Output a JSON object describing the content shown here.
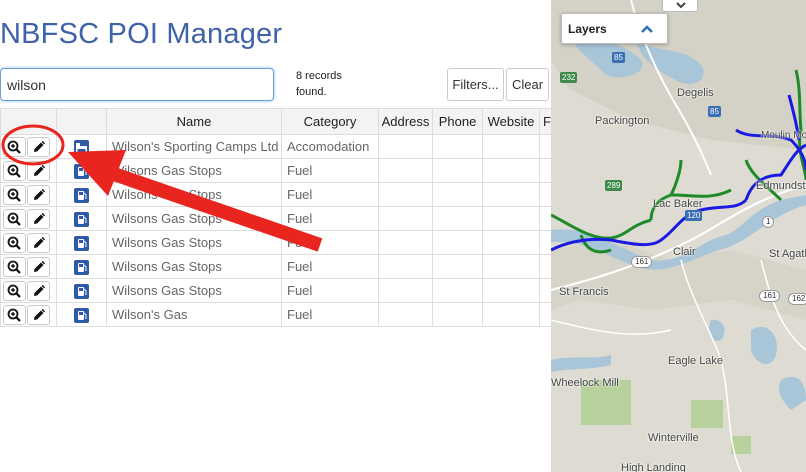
{
  "app": {
    "title": "NBFSC POI Manager"
  },
  "search": {
    "value": "wilson"
  },
  "records": {
    "line1": "8 records",
    "line2": "found."
  },
  "buttons": {
    "filters": "Filters...",
    "clear": "Clear"
  },
  "columns": [
    "Name",
    "Category",
    "Address",
    "Phone",
    "Website",
    "F"
  ],
  "rows": [
    {
      "name": "Wilson's Sporting Camps Ltd",
      "category": "Accomodation",
      "icon": "bed-icon"
    },
    {
      "name": "Wilsons Gas Stops",
      "category": "Fuel",
      "icon": "fuel-icon"
    },
    {
      "name": "Wilsons Gas Stops",
      "category": "Fuel",
      "icon": "fuel-icon"
    },
    {
      "name": "Wilsons Gas Stops",
      "category": "Fuel",
      "icon": "fuel-icon"
    },
    {
      "name": "Wilsons Gas Stops",
      "category": "Fuel",
      "icon": "fuel-icon"
    },
    {
      "name": "Wilsons Gas Stops",
      "category": "Fuel",
      "icon": "fuel-icon"
    },
    {
      "name": "Wilsons Gas Stops",
      "category": "Fuel",
      "icon": "fuel-icon"
    },
    {
      "name": "Wilson's Gas",
      "category": "Fuel",
      "icon": "fuel-icon"
    }
  ],
  "map": {
    "layers_label": "Layers",
    "places": [
      "Degelis",
      "Packington",
      "Edmundston",
      "Lac Baker",
      "Clair",
      "St Agatha",
      "St Francis",
      "Eagle Lake",
      "Wheelock Mill",
      "Winterville",
      "High Landing",
      "Moulin Morneault"
    ],
    "shields": [
      "85",
      "85",
      "232",
      "289",
      "161",
      "161",
      "1",
      "162",
      "120"
    ]
  },
  "colors": {
    "title": "#3f63a8",
    "trail_blue": "#1a1ae0",
    "trail_green": "#1f8a2a",
    "annotation_red": "#e8251f",
    "map_bg": "#dcdcd3",
    "water": "#a6c3d8",
    "forest": "#b4cf9a"
  }
}
